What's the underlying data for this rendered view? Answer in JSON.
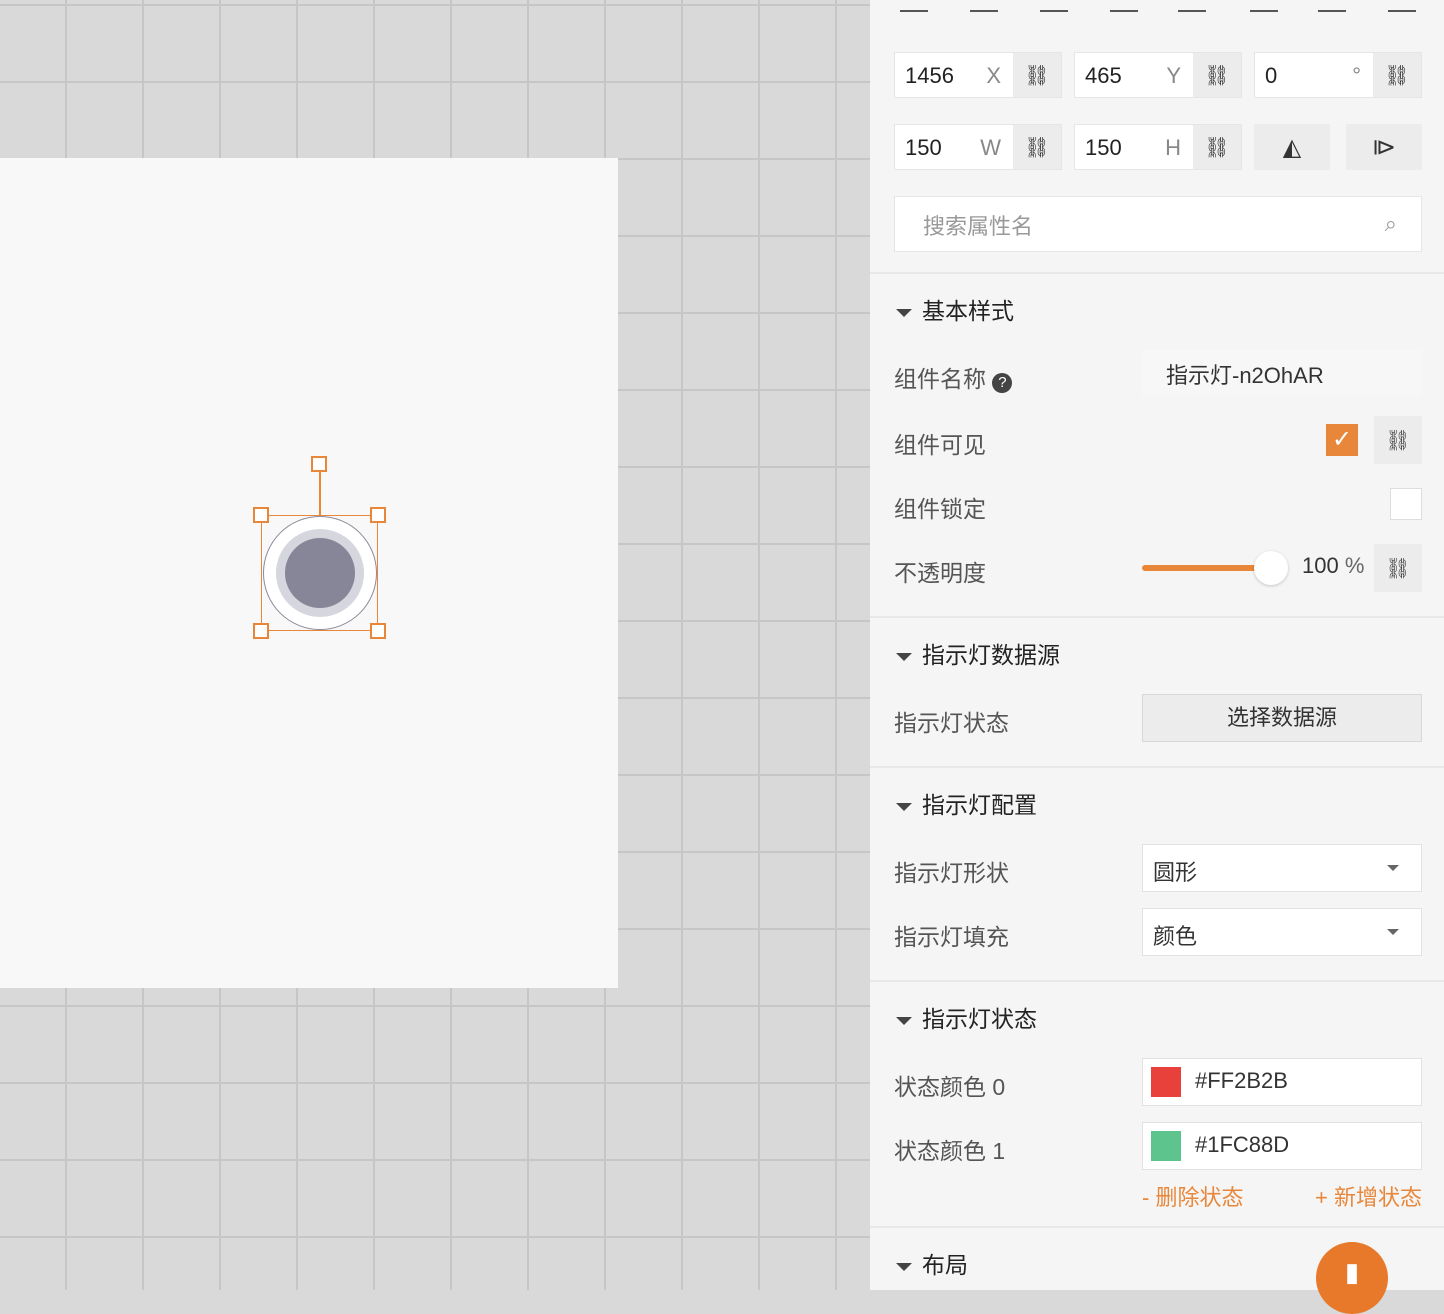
{
  "transform": {
    "x": "1456",
    "x_label": "X",
    "y": "465",
    "y_label": "Y",
    "rotation": "0",
    "rotation_unit": "°",
    "w": "150",
    "w_label": "W",
    "h": "150",
    "h_label": "H"
  },
  "search": {
    "placeholder": "搜索属性名"
  },
  "sections": {
    "basic": {
      "title": "基本样式",
      "name_label": "组件名称",
      "name_value": "指示灯-n2OhAR",
      "visible_label": "组件可见",
      "visible": true,
      "lock_label": "组件锁定",
      "locked": false,
      "opacity_label": "不透明度",
      "opacity": "100",
      "opacity_unit": "%"
    },
    "datasource": {
      "title": "指示灯数据源",
      "state_label": "指示灯状态",
      "button": "选择数据源"
    },
    "config": {
      "title": "指示灯配置",
      "shape_label": "指示灯形状",
      "shape_value": "圆形",
      "fill_label": "指示灯填充",
      "fill_value": "颜色"
    },
    "state": {
      "title": "指示灯状态",
      "colors": [
        {
          "label": "状态颜色 0",
          "value": "#FF2B2B",
          "swatch": "#e8403a"
        },
        {
          "label": "状态颜色 1",
          "value": "#1FC88D",
          "swatch": "#5ec48e"
        }
      ],
      "delete": "- 删除状态",
      "add": "+ 新增状态"
    },
    "layout": {
      "title": "布局"
    }
  },
  "colors": {
    "accent": "#e8873a"
  }
}
